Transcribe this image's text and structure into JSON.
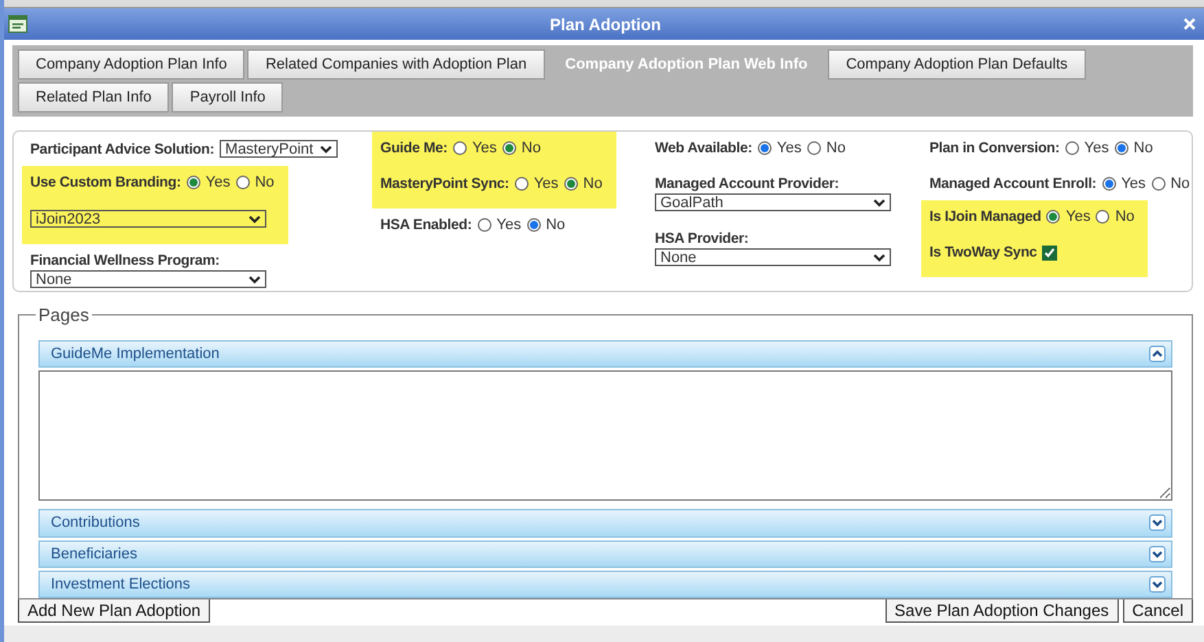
{
  "window": {
    "title": "Plan Adoption"
  },
  "tabs": [
    [
      {
        "label": "Company Adoption Plan Info",
        "selected": false
      },
      {
        "label": "Related Companies with Adoption Plan",
        "selected": false
      },
      {
        "label": "Company Adoption Plan Web Info",
        "selected": true
      },
      {
        "label": "Company Adoption Plan Defaults",
        "selected": false
      }
    ],
    [
      {
        "label": "Related Plan Info",
        "selected": false
      },
      {
        "label": "Payroll Info",
        "selected": false
      }
    ]
  ],
  "form": {
    "columns": [
      {
        "groups": [
          {
            "highlighted": false,
            "fields": [
              {
                "kind": "inline-select",
                "label": "Participant Advice Solution:",
                "value": "MasteryPoint"
              }
            ]
          },
          {
            "highlighted": true,
            "fields": [
              {
                "kind": "radio",
                "label": "Use Custom Branding:",
                "options": [
                  {
                    "label": "Yes",
                    "selected": true
                  },
                  {
                    "label": "No",
                    "selected": false
                  }
                ]
              },
              {
                "kind": "select",
                "value": "iJoin2023"
              }
            ]
          },
          {
            "highlighted": false,
            "fields": [
              {
                "kind": "select",
                "label": "Financial Wellness Program:",
                "value": "None"
              }
            ]
          }
        ]
      },
      {
        "groups": [
          {
            "highlighted": true,
            "fields": [
              {
                "kind": "radio",
                "label": "Guide Me:",
                "options": [
                  {
                    "label": "Yes",
                    "selected": false
                  },
                  {
                    "label": "No",
                    "selected": true
                  }
                ]
              },
              {
                "kind": "radio",
                "label": "MasteryPoint Sync:",
                "options": [
                  {
                    "label": "Yes",
                    "selected": false
                  },
                  {
                    "label": "No",
                    "selected": true
                  }
                ]
              }
            ]
          },
          {
            "highlighted": false,
            "fields": [
              {
                "kind": "radio",
                "label": "HSA Enabled:",
                "options": [
                  {
                    "label": "Yes",
                    "selected": false
                  },
                  {
                    "label": "No",
                    "selected": true
                  }
                ]
              }
            ]
          }
        ]
      },
      {
        "groups": [
          {
            "highlighted": false,
            "fields": [
              {
                "kind": "radio",
                "label": "Web Available:",
                "options": [
                  {
                    "label": "Yes",
                    "selected": true
                  },
                  {
                    "label": "No",
                    "selected": false
                  }
                ]
              },
              {
                "kind": "select",
                "label": "Managed Account Provider:",
                "value": "GoalPath"
              },
              {
                "kind": "select",
                "label": "HSA Provider:",
                "value": "None"
              }
            ]
          }
        ]
      },
      {
        "groups": [
          {
            "highlighted": false,
            "fields": [
              {
                "kind": "radio",
                "label": "Plan in Conversion:",
                "options": [
                  {
                    "label": "Yes",
                    "selected": false
                  },
                  {
                    "label": "No",
                    "selected": true
                  }
                ]
              },
              {
                "kind": "radio",
                "label": "Managed Account Enroll:",
                "options": [
                  {
                    "label": "Yes",
                    "selected": true
                  },
                  {
                    "label": "No",
                    "selected": false
                  }
                ]
              }
            ]
          },
          {
            "highlighted": true,
            "fields": [
              {
                "kind": "radio",
                "label": "Is IJoin Managed",
                "options": [
                  {
                    "label": "Yes",
                    "selected": true
                  },
                  {
                    "label": "No",
                    "selected": false
                  }
                ]
              },
              {
                "kind": "checkbox",
                "label": "Is TwoWay Sync",
                "checked": true
              }
            ]
          }
        ]
      }
    ]
  },
  "pages": {
    "legend": "Pages",
    "sections": [
      {
        "title": "GuideMe Implementation",
        "expanded": true
      },
      {
        "title": "Contributions",
        "expanded": false
      },
      {
        "title": "Beneficiaries",
        "expanded": false
      },
      {
        "title": "Investment Elections",
        "expanded": false
      }
    ]
  },
  "buttons": {
    "left": [
      "Add New Plan Adoption"
    ],
    "right": [
      "Save Plan Adoption Changes",
      "Cancel"
    ]
  }
}
